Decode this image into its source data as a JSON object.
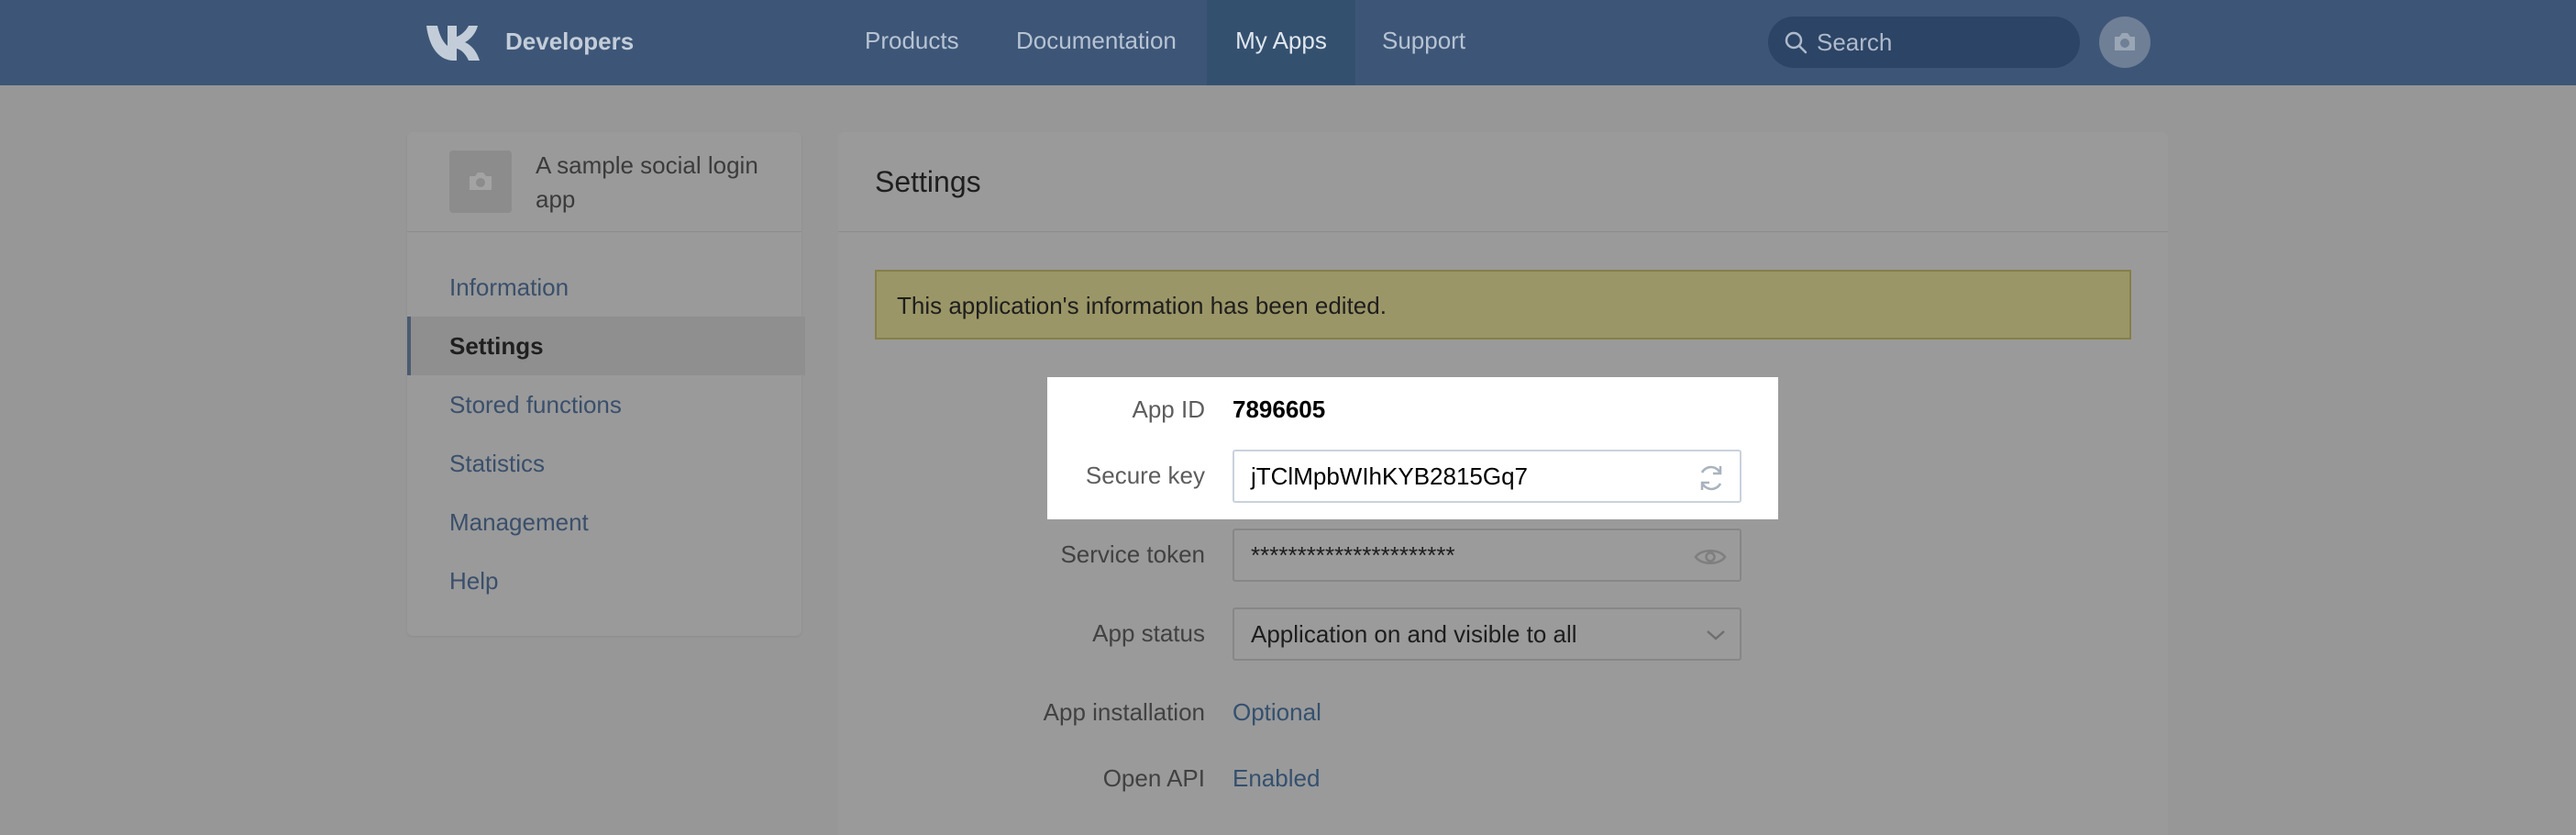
{
  "header": {
    "brand": "Developers",
    "nav": [
      "Products",
      "Documentation",
      "My Apps",
      "Support"
    ],
    "active_nav": "My Apps",
    "search_placeholder": "Search"
  },
  "sidebar": {
    "app_name": "A sample social login app",
    "items": [
      "Information",
      "Settings",
      "Stored functions",
      "Statistics",
      "Management",
      "Help"
    ],
    "active_item": "Settings"
  },
  "main": {
    "title": "Settings",
    "notice": "This application's information has been edited.",
    "fields": {
      "app_id_label": "App ID",
      "app_id_value": "7896605",
      "secure_key_label": "Secure key",
      "secure_key_value": "jTClMpbWIhKYB2815Gq7",
      "service_token_label": "Service token",
      "service_token_value": "**********************",
      "app_status_label": "App status",
      "app_status_value": "Application on and visible to all",
      "app_installation_label": "App installation",
      "app_installation_value": "Optional",
      "open_api_label": "Open API",
      "open_api_value": "Enabled"
    }
  },
  "colors": {
    "header_bg": "#3d5677",
    "link": "#34506f",
    "overlay_dim": "#979797",
    "highlight_bg": "#ffffff"
  },
  "icons": [
    "vk-logo-icon",
    "search-icon",
    "camera-icon",
    "refresh-icon",
    "eye-icon",
    "chevron-down-icon"
  ]
}
